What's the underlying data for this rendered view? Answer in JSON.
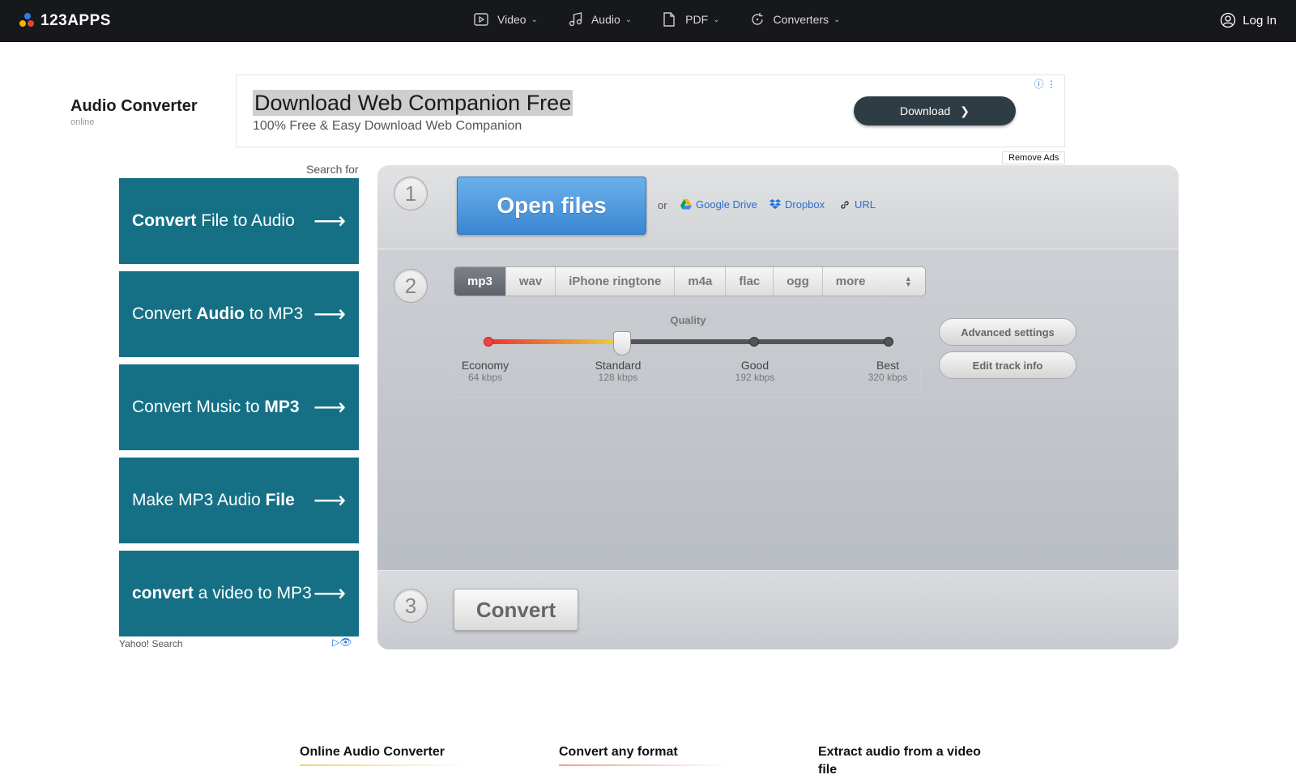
{
  "topbar": {
    "logo_text": "123APPS",
    "nav": [
      {
        "label": "Video",
        "icon": "video-icon"
      },
      {
        "label": "Audio",
        "icon": "music-note-icon"
      },
      {
        "label": "PDF",
        "icon": "document-icon"
      },
      {
        "label": "Converters",
        "icon": "refresh-icon"
      }
    ],
    "login_label": "Log In"
  },
  "app": {
    "title": "Audio Converter",
    "subtitle": "online"
  },
  "ad": {
    "headline": "Download Web Companion Free",
    "description": "100% Free & Easy Download Web Companion",
    "button_label": "Download",
    "remove_ads": "Remove Ads"
  },
  "search_ads": {
    "header": "Search for",
    "items": [
      {
        "parts": [
          {
            "t": "Convert",
            "b": true
          },
          {
            "t": " File to Audio",
            "b": false
          }
        ]
      },
      {
        "parts": [
          {
            "t": "Convert ",
            "b": false
          },
          {
            "t": "Audio",
            "b": true
          },
          {
            "t": " to MP3",
            "b": false
          }
        ]
      },
      {
        "parts": [
          {
            "t": "Convert Music to ",
            "b": false
          },
          {
            "t": "MP3",
            "b": true
          }
        ]
      },
      {
        "parts": [
          {
            "t": "Make MP3 Audio ",
            "b": false
          },
          {
            "t": "File",
            "b": true
          }
        ]
      },
      {
        "parts": [
          {
            "t": "convert",
            "b": true
          },
          {
            "t": " a video to MP3",
            "b": false
          }
        ]
      }
    ],
    "footer": "Yahoo! Search"
  },
  "converter": {
    "steps": [
      "1",
      "2",
      "3"
    ],
    "open_files": "Open files",
    "or": "or",
    "sources": [
      "Google Drive",
      "Dropbox",
      "URL"
    ],
    "formats": [
      "mp3",
      "wav",
      "iPhone ringtone",
      "m4a",
      "flac",
      "ogg",
      "more"
    ],
    "selected_format": "mp3",
    "quality": {
      "label": "Quality",
      "stops": [
        {
          "name": "Economy",
          "kbps": "64 kbps"
        },
        {
          "name": "Standard",
          "kbps": "128 kbps"
        },
        {
          "name": "Good",
          "kbps": "192 kbps"
        },
        {
          "name": "Best",
          "kbps": "320 kbps"
        }
      ],
      "selected_index": 1
    },
    "advanced_settings": "Advanced settings",
    "edit_track_info": "Edit track info",
    "convert_label": "Convert"
  },
  "features": [
    {
      "title": "Online Audio Converter",
      "color": "#f3d36b"
    },
    {
      "title": "Convert any format",
      "color": "#f39c8a"
    },
    {
      "title": "Extract audio from a video file",
      "color": "#ffffff"
    }
  ]
}
